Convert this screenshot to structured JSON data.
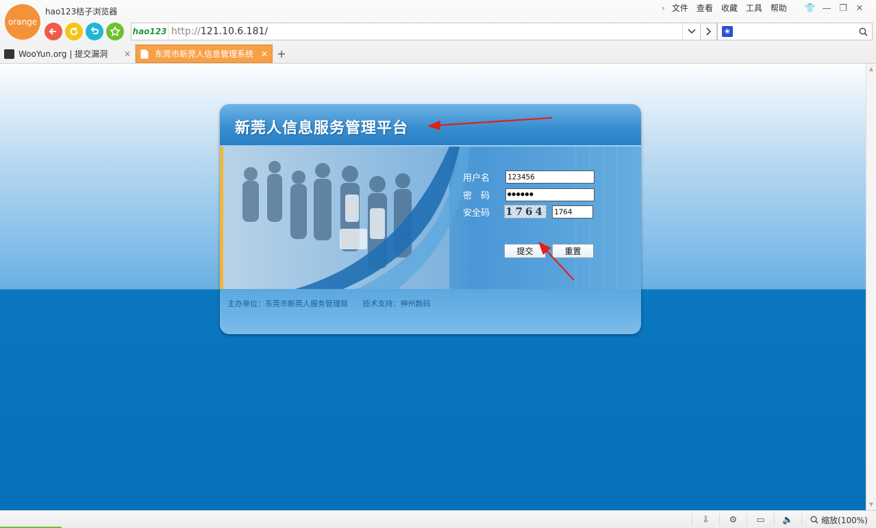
{
  "browser": {
    "logo_text": "orange",
    "app_title": "hao123桔子浏览器",
    "menu": [
      "文件",
      "查看",
      "收藏",
      "工具",
      "帮助"
    ],
    "address": {
      "brand": "hao123",
      "scheme": "http://",
      "host": "121.10.6.181",
      "path": "/"
    },
    "tabs": [
      {
        "label": "WooYun.org | 提交漏洞",
        "active": false
      },
      {
        "label": "东莞市新莞人信息管理系统",
        "active": true
      }
    ],
    "status": {
      "zoom": "缩放(100%)"
    }
  },
  "page": {
    "title": "新莞人信息服务管理平台",
    "form": {
      "username_label": "用户名",
      "username_value": "123456",
      "password_label": "密　码",
      "password_value": "●●●●●●",
      "captcha_label": "安全码",
      "captcha_image_text": "1764",
      "captcha_value": "1764",
      "submit_label": "提交",
      "reset_label": "重置"
    },
    "footer": {
      "host": "主办单位：东莞市新莞人服务管理局",
      "support": "技术支持：神州数码"
    }
  },
  "colors": {
    "accent_orange": "#f7a046",
    "page_blue": "#0670bb",
    "annotation_red": "#e0201c"
  }
}
